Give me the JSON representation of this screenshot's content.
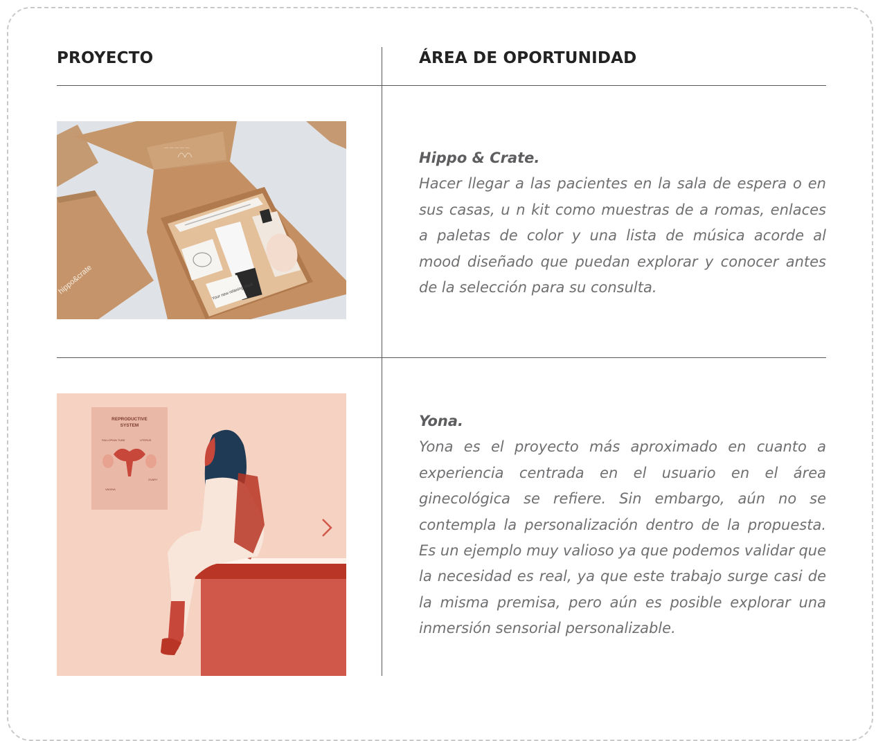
{
  "headers": {
    "project": "PROYECTO",
    "opportunity": "ÁREA DE OPORTUNIDAD"
  },
  "rows": [
    {
      "title": "Hippo & Crate.",
      "body": "Hacer llegar a las pacientes en la sala de espera o en sus casas, u n  kit  como  muestras  de a romas,  enlaces a  paletas de color y una lista de música acorde al mood diseñado que puedan explorar y conocer antes de la selección para su consulta.",
      "image_text": {
        "brand": "hippo&crate",
        "card": "Your new relaxing ritual"
      }
    },
    {
      "title": "Yona.",
      "body": "Yona es el proyecto más aproximado en cuanto a experiencia centrada en el usuario en el área ginecológica se refiere. Sin embargo, aún no se contempla la personalización dentro de la propuesta. Es un ejemplo muy valioso ya que podemos validar que la necesidad es real, ya que este trabajo surge casi de la misma premisa, pero aún es posible explorar una inmersión sensorial personalizable.",
      "image_text": {
        "poster_title": "REPRODUCTIVE SYSTEM",
        "label_tube": "FALLOPIAN TUBE",
        "label_uterus": "UTERUS",
        "label_ovary": "OVARY",
        "label_vagina": "VAGINA"
      }
    }
  ],
  "icons": {
    "carousel_next": "chevron-right-icon"
  },
  "colors": {
    "kraft": "#c89a70",
    "salmon": "#f6d2c3",
    "red": "#c2432f",
    "navy": "#1d3953",
    "text": "#6f6f72"
  }
}
